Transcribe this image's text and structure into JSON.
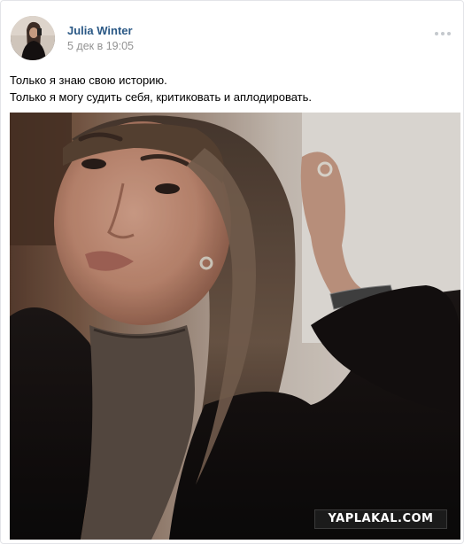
{
  "post": {
    "author": "Julia Winter",
    "date": "5 дек в 19:05",
    "text_lines": [
      "Только я знаю свою историю.",
      "Только я могу судить себя, критиковать и аплодировать."
    ]
  },
  "watermark": "YAPLAKAL.COM",
  "colors": {
    "author_link": "#2a5885",
    "date_gray": "#939393",
    "border": "#e3e4e8"
  },
  "icons": {
    "more": "more-dots-icon"
  }
}
